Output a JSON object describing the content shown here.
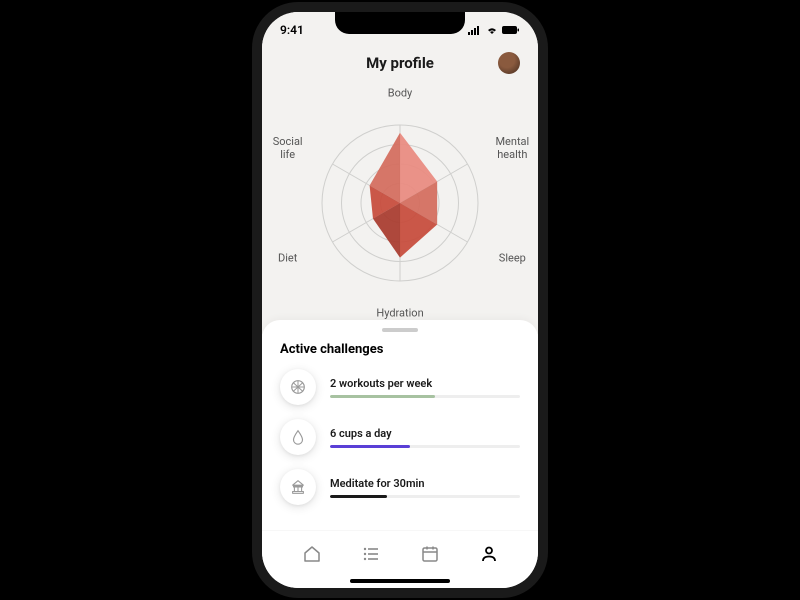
{
  "status": {
    "time": "9:41"
  },
  "header": {
    "title": "My profile"
  },
  "chart_data": {
    "type": "radar",
    "title": "",
    "categories": [
      "Body",
      "Mental health",
      "Sleep",
      "Hydration",
      "Diet",
      "Social life"
    ],
    "scale_max": 100,
    "series": [
      {
        "name": "profile",
        "values": [
          90,
          55,
          55,
          70,
          40,
          45
        ]
      }
    ],
    "fill_colors": [
      "#e98a7f",
      "#d46b5c",
      "#c74a3a",
      "#a83a2d",
      "#c74a3a",
      "#d46b5c"
    ],
    "grid_color": "#cfcfcd",
    "label_color": "#555555"
  },
  "challenges": {
    "section_title": "Active challenges",
    "items": [
      {
        "label": "2 workouts per week",
        "progress": 55,
        "color": "#a7c2a1",
        "icon": "basketball"
      },
      {
        "label": "6 cups a day",
        "progress": 42,
        "color": "#5a3fd6",
        "icon": "droplet"
      },
      {
        "label": "Meditate for 30min",
        "progress": 30,
        "color": "#1a1a1a",
        "icon": "temple"
      }
    ]
  },
  "nav": {
    "items": [
      {
        "name": "home",
        "active": false
      },
      {
        "name": "list",
        "active": false
      },
      {
        "name": "calendar",
        "active": false
      },
      {
        "name": "profile",
        "active": true
      }
    ]
  }
}
